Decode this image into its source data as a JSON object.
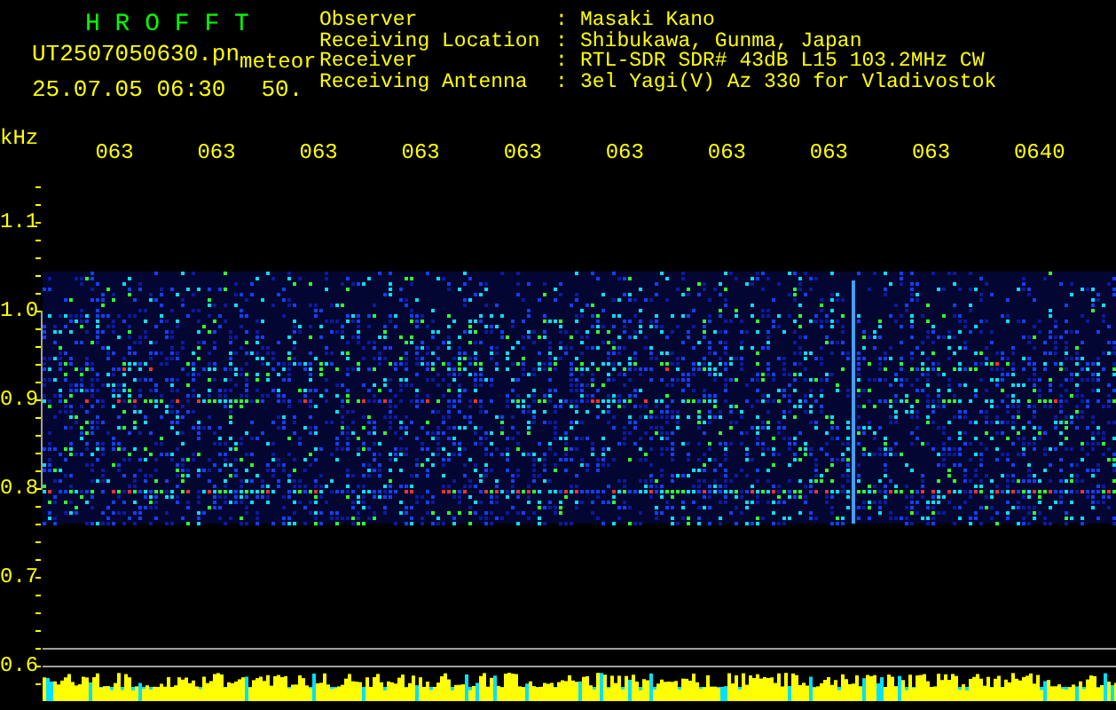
{
  "header": {
    "title": "H R O F F T",
    "file_name": "UT2507050630.pn",
    "mode": "meteor",
    "date_time": "25.07.05 06:30",
    "value": "50."
  },
  "info": [
    {
      "label": "Observer",
      "separator": ":",
      "value": "Masaki Kano"
    },
    {
      "label": "Receiving Location",
      "separator": ":",
      "value": "Shibukawa, Gunma, Japan"
    },
    {
      "label": "Receiver",
      "separator": ":",
      "value": "RTL-SDR SDR# 43dB L15 103.2MHz CW"
    },
    {
      "label": "Receiving Antenna",
      "separator": ":",
      "value": "3el Yagi(V) Az 330 for Vladivostok"
    }
  ],
  "axis": {
    "unit": "kHz",
    "time_labels": [
      "063",
      "063",
      "063",
      "063",
      "063",
      "063",
      "063",
      "063",
      "063",
      "0640"
    ],
    "freq_labels": [
      "1.1",
      "1.0",
      "0.9",
      "0.8",
      "0.7",
      "0.6"
    ]
  }
}
